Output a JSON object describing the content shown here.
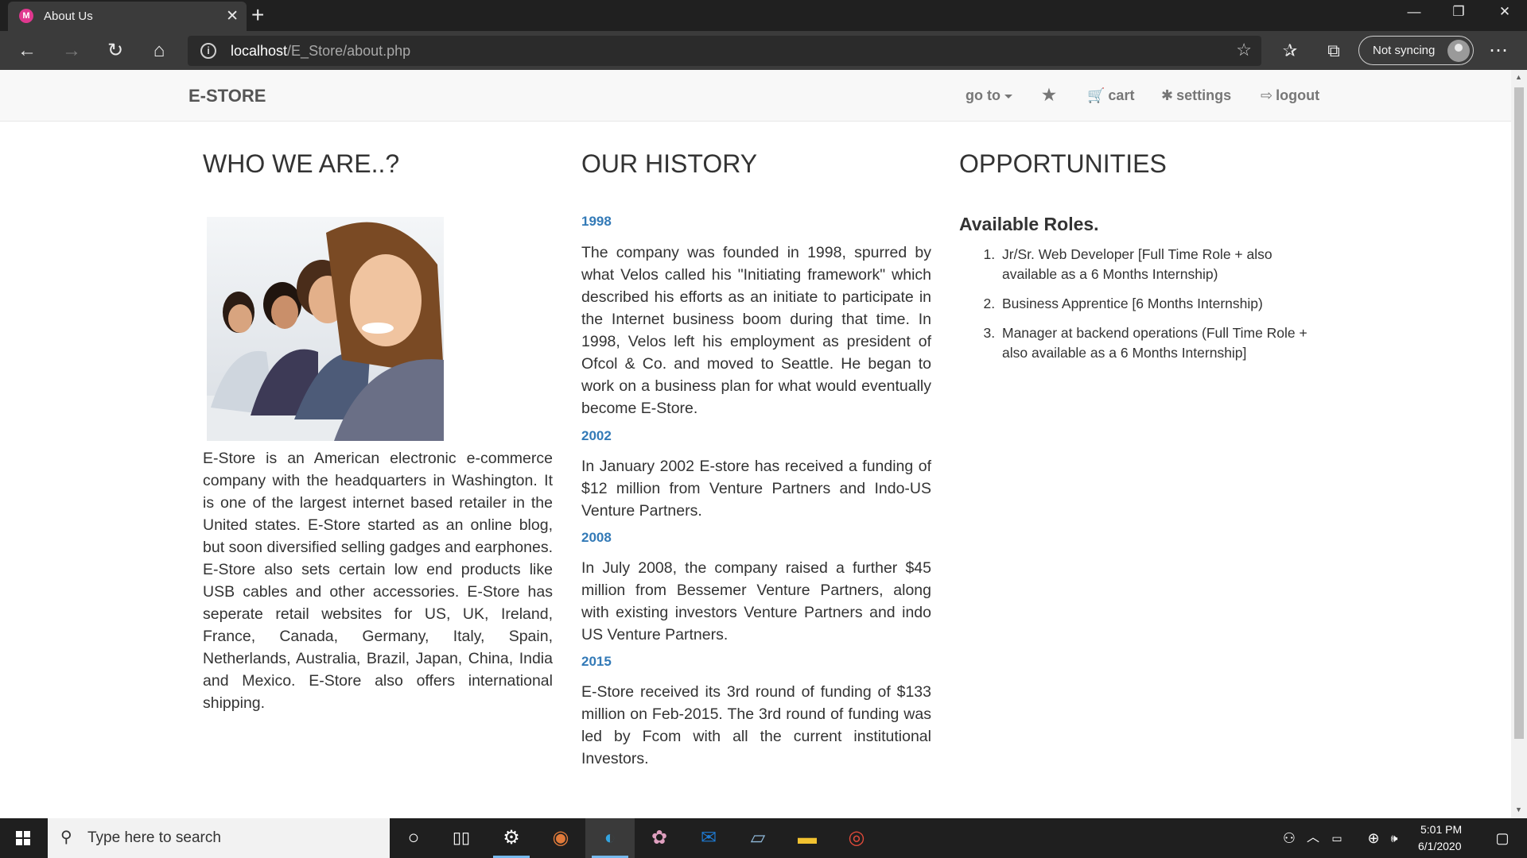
{
  "browser": {
    "tab_title": "About Us",
    "tab_favicon_letter": "M",
    "url_host": "localhost",
    "url_path": "/E_Store/about.php",
    "sync_label": "Not syncing"
  },
  "navbar": {
    "brand": "E-STORE",
    "goto_label": "go to",
    "cart_label": "cart",
    "settings_label": "settings",
    "logout_label": "logout"
  },
  "who": {
    "heading": "WHO WE ARE..?",
    "text": "E-Store is an American electronic e-commerce company with the headquarters in Washington. It is one of the largest internet based retailer in the United states. E-Store started as an online blog, but soon diversified selling gadges and earphones. E-Store also sets certain low end products like USB cables and other accessories. E-Store has seperate retail websites for US, UK, Ireland, France, Canada, Germany, Italy, Spain, Netherlands, Australia, Brazil, Japan, China, India and Mexico. E-Store also offers international shipping."
  },
  "history": {
    "heading": "OUR HISTORY",
    "entries": [
      {
        "year": "1998",
        "text": "The company was founded in 1998, spurred by what Velos called his \"Initiating framework\" which described his efforts as an initiate to participate in the Internet business boom during that time. In 1998, Velos left his employment as president of Ofcol & Co. and moved to Seattle. He began to work on a business plan for what would eventually become E-Store."
      },
      {
        "year": "2002",
        "text": "In January 2002 E-store has received a funding of $12 million from Venture Partners and Indo-US Venture Partners."
      },
      {
        "year": "2008",
        "text": "In July 2008, the company raised a further $45 million from Bessemer Venture Partners, along with existing investors Venture Partners and indo US Venture Partners."
      },
      {
        "year": "2015",
        "text": "E-Store received its 3rd round of funding of $133 million on Feb-2015. The 3rd round of funding was led by Fcom with all the current institutional Investors."
      }
    ]
  },
  "opportunities": {
    "heading": "OPPORTUNITIES",
    "subheading": "Available Roles.",
    "roles": [
      "Jr/Sr. Web Developer [Full Time Role + also available as a 6 Months Internship)",
      "Business Apprentice [6 Months Internship)",
      "Manager at backend operations (Full Time Role + also available as a 6 Months Internship]"
    ]
  },
  "taskbar": {
    "search_placeholder": "Type here to search",
    "time": "5:01 PM",
    "date": "6/1/2020"
  },
  "colors": {
    "year_accent": "#337ab7",
    "navbar_bg": "#f8f8f8",
    "browser_dark": "#3b3b3b"
  }
}
